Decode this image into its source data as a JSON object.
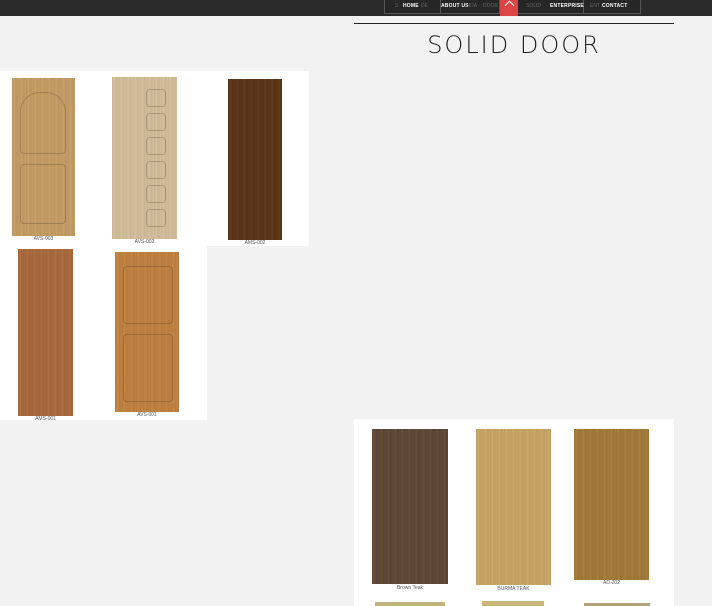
{
  "nav": {
    "items": [
      "HOME",
      "ABOUT US",
      "ENTERPRISE",
      "CONTACT"
    ],
    "ghost": [
      "S",
      "DE",
      "LIDA",
      "DOOR",
      "SOLID",
      "ENT"
    ]
  },
  "page": {
    "title": "SOLID DOOR"
  },
  "gallery_a": [
    {
      "code": "AVS-003",
      "color": "#c49b62"
    },
    {
      "code": "AVS-002",
      "color": "#d2bd98"
    },
    {
      "code": "AMS-002",
      "color": "#5a3214"
    },
    {
      "code": "AMS-001",
      "color": "#a8683a"
    },
    {
      "code": "AVS-001",
      "color": "#c0803f"
    }
  ],
  "gallery_b": [
    {
      "code": "Brown Teak",
      "color": "#5b4632"
    },
    {
      "code": "BURMA TEAK",
      "color": "#c8a463"
    },
    {
      "code": "AD-202",
      "color": "#a27836"
    }
  ]
}
